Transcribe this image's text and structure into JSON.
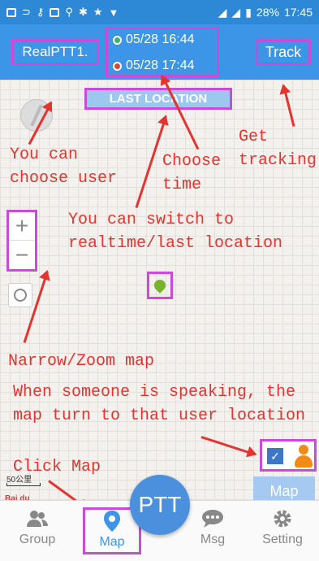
{
  "status_bar": {
    "battery": "28%",
    "time": "17:45"
  },
  "app_bar": {
    "user_button": "RealPTT1.",
    "time_start": "05/28 16:44",
    "time_end": "05/28 17:44",
    "track_button": "Track",
    "colors": {
      "start_dot": "#3fb56a",
      "end_dot": "#e0452f"
    }
  },
  "map": {
    "mode_toggle": "LAST LOCATION",
    "zoom_in": "+",
    "zoom_out": "−",
    "scale_label": "50公里",
    "brand": "Bai du"
  },
  "annotations": {
    "choose_user": "You can\nchoose user",
    "choose_time": "Choose\ntime",
    "get_tracking": "Get\ntracking",
    "switch_mode": "You can switch to\nrealtime/last location",
    "zoom": "Narrow/Zoom map",
    "speaking": "When someone is speaking, the\nmap turn to that user location",
    "click_map": "Click Map",
    "color": "#e4342f"
  },
  "speak_overlay": {
    "check": "✓"
  },
  "map_button": "Map",
  "ptt_button": "PTT",
  "tabs": [
    {
      "label": "Group",
      "icon": "group-icon"
    },
    {
      "label": "Map",
      "icon": "map-pin-icon"
    },
    {
      "label": "Msg",
      "icon": "chat-icon"
    },
    {
      "label": "Setting",
      "icon": "gear-icon"
    }
  ],
  "highlight_color": "#c94bd8"
}
